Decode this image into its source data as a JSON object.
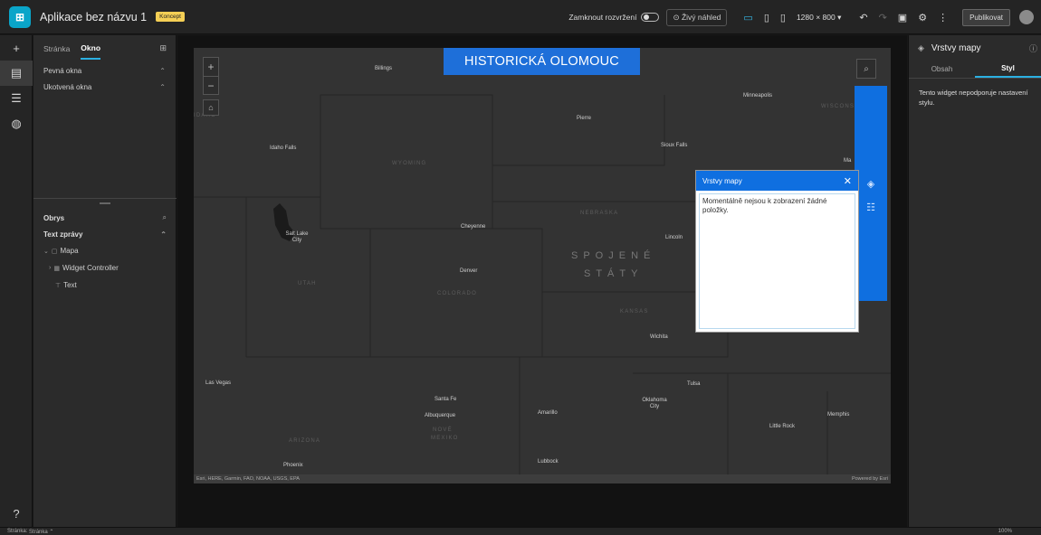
{
  "header": {
    "app_name": "Aplikace bez názvu 1",
    "badge": "Koncept",
    "lock_label": "Zamknout rozvržení",
    "live_view": "Živý náhled",
    "resolution": "1280 × 800",
    "publish": "Publikovat"
  },
  "left_panel": {
    "tabs": [
      "Stránka",
      "Okno"
    ],
    "active_tab": "Okno",
    "sections": [
      "Pevná okna",
      "Ukotvená okna"
    ]
  },
  "outline": {
    "title": "Obrys",
    "group": "Text zprávy",
    "items": [
      "Mapa",
      "Widget Controller",
      "Text"
    ]
  },
  "map": {
    "title": "HISTORICKÁ OLOMOUC",
    "country_line1": "SPOJENÉ",
    "country_line2": "STÁTY",
    "attribution": "Esri, HERE, Garmin, FAO, NOAA, USGS, EPA",
    "powered": "Powered by Esri",
    "cities": [
      "Billings",
      "Minneapolis",
      "Pierre",
      "Idaho Falls",
      "Sioux Falls",
      "Salt Lake City",
      "Cheyenne",
      "Lincoln",
      "Denver",
      "Wichita",
      "Las Vegas",
      "Tulsa",
      "Santa Fe",
      "Oklahoma City",
      "Albuquerque",
      "Amarillo",
      "Memphis",
      "Little Rock",
      "Phoenix",
      "Lubbock",
      "Ma"
    ],
    "states": [
      "WYOMING",
      "NEBRASKA",
      "UTAH",
      "COLORADO",
      "KANSAS",
      "ARIZONA",
      "NOVÉ",
      "MEXIKO",
      "IDAHO",
      "WISCONS"
    ]
  },
  "popup": {
    "title": "Vrstvy mapy",
    "message": "Momentálně nejsou k zobrazení žádné položky."
  },
  "right_panel": {
    "title": "Vrstvy mapy",
    "tabs": [
      "Obsah",
      "Styl"
    ],
    "active_tab": "Styl",
    "message": "Tento widget nepodporuje nastavení stylu."
  },
  "status": {
    "label": "Stránka:",
    "page": "Stránka ⌃",
    "zoom": "100%"
  },
  "colors": {
    "accent": "#0f6fe0",
    "tab_underline": "#2bb0e2",
    "badge": "#f5cf55"
  }
}
